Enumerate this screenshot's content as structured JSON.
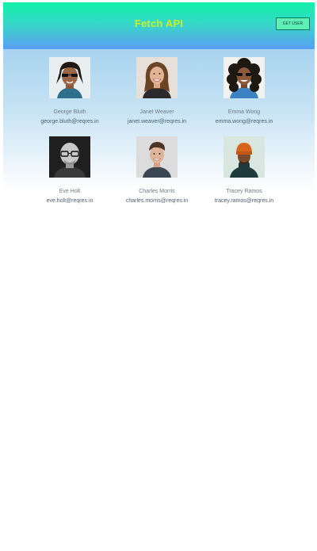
{
  "header": {
    "title": "Fetch API",
    "button_label": "GET USER"
  },
  "users": [
    {
      "name": "George Bluth",
      "email": "george.bluth@reqres.in",
      "avatar": "man-sunglasses-dreadlocks",
      "bg": "#e9eef0"
    },
    {
      "name": "Janet Weaver",
      "email": "janet.weaver@reqres.in",
      "avatar": "woman-smiling-brown-hair",
      "bg": "#e6e0d8"
    },
    {
      "name": "Emma Wong",
      "email": "emma.wong@reqres.in",
      "avatar": "woman-curly-hair-sunglasses",
      "bg": "#f1f1ef"
    },
    {
      "name": "Eve Holt",
      "email": "eve.holt@reqres.in",
      "avatar": "bald-man-glasses-bw",
      "bg": "#202020"
    },
    {
      "name": "Charles Morris",
      "email": "charles.morris@reqres.in",
      "avatar": "man-smiling-short-hair",
      "bg": "#dcdcdc"
    },
    {
      "name": "Tracey Ramos",
      "email": "tracey.ramos@reqres.in",
      "avatar": "man-orange-beanie",
      "bg": "#d9e6df"
    }
  ]
}
